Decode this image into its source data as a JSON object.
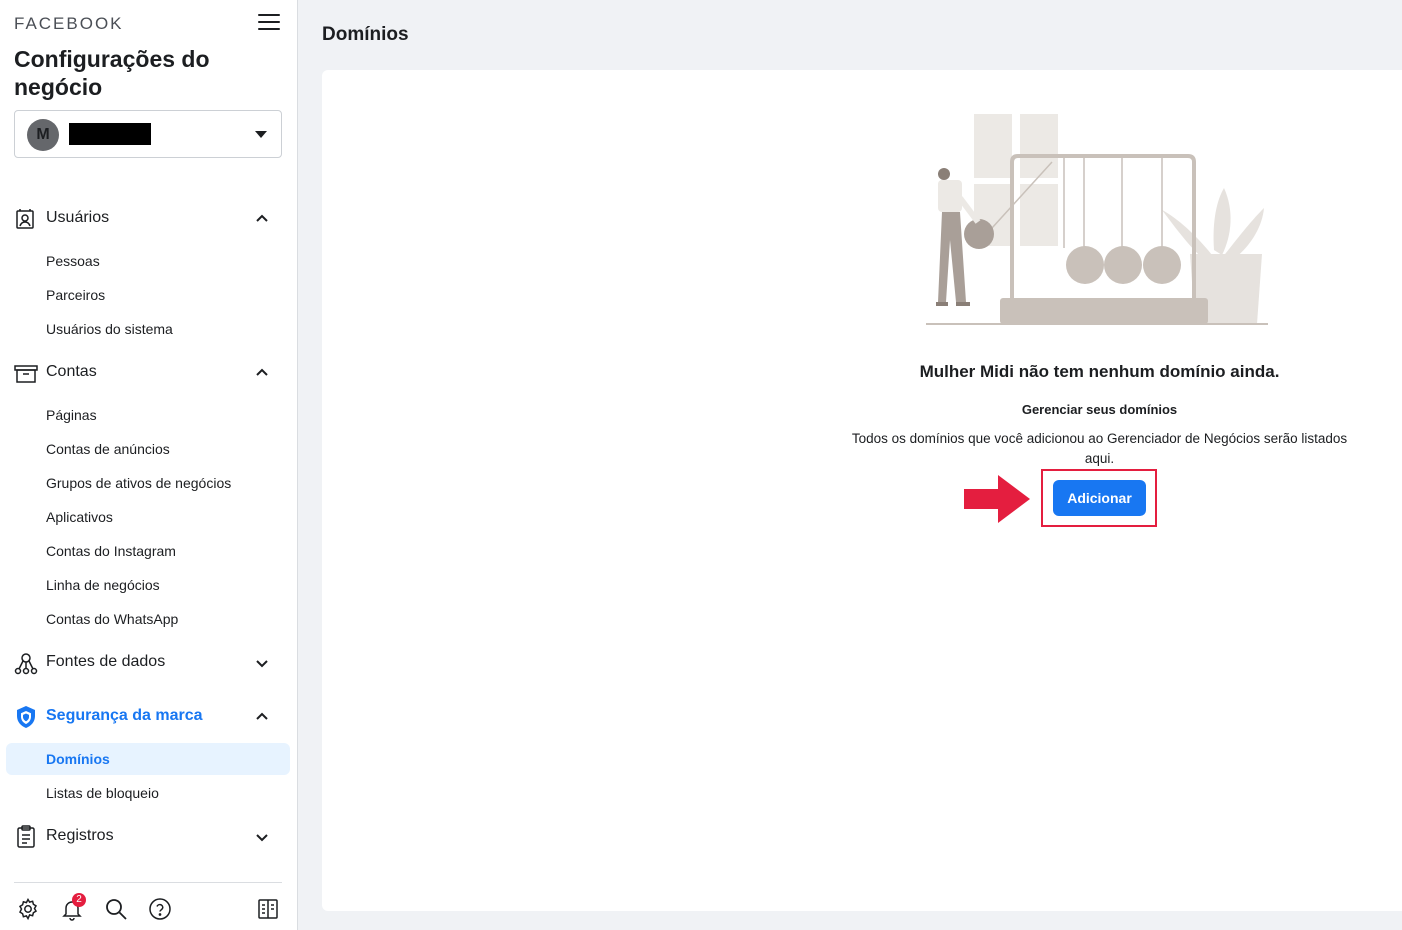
{
  "sidebar": {
    "brand": "FACEBOOK",
    "title": "Configurações do negócio",
    "business": {
      "avatar_letter": "M",
      "name": "Mulher Midi"
    },
    "sections": [
      {
        "label": "Usuários",
        "icon": "users-icon",
        "expanded": true,
        "items": [
          "Pessoas",
          "Parceiros",
          "Usuários do sistema"
        ]
      },
      {
        "label": "Contas",
        "icon": "accounts-icon",
        "expanded": true,
        "items": [
          "Páginas",
          "Contas de anúncios",
          "Grupos de ativos de negócios",
          "Aplicativos",
          "Contas do Instagram",
          "Linha de negócios",
          "Contas do WhatsApp"
        ]
      },
      {
        "label": "Fontes de dados",
        "icon": "data-sources-icon",
        "expanded": false,
        "items": []
      },
      {
        "label": "Segurança da marca",
        "icon": "shield-icon",
        "expanded": true,
        "active": true,
        "items": [
          "Domínios",
          "Listas de bloqueio"
        ]
      },
      {
        "label": "Registros",
        "icon": "clipboard-icon",
        "expanded": false,
        "items": []
      }
    ],
    "selected_item": "Domínios",
    "bottom": {
      "icons": [
        "settings-icon",
        "bell-icon",
        "search-icon",
        "help-icon",
        "panel-toggle-icon"
      ],
      "notification_count": "2"
    }
  },
  "main": {
    "page_title": "Domínios",
    "empty_state": {
      "heading": "Mulher Midi não tem nenhum domínio ainda.",
      "subheading": "Gerenciar seus domínios",
      "description": "Todos os domínios que você adicionou ao Gerenciador de Negócios serão listados aqui.",
      "add_button": "Adicionar"
    }
  },
  "colors": {
    "accent": "#1877f2",
    "selected_bg": "#e7f3ff",
    "annotation_red": "#e41e3f",
    "illustration": "#c9c1ba"
  }
}
